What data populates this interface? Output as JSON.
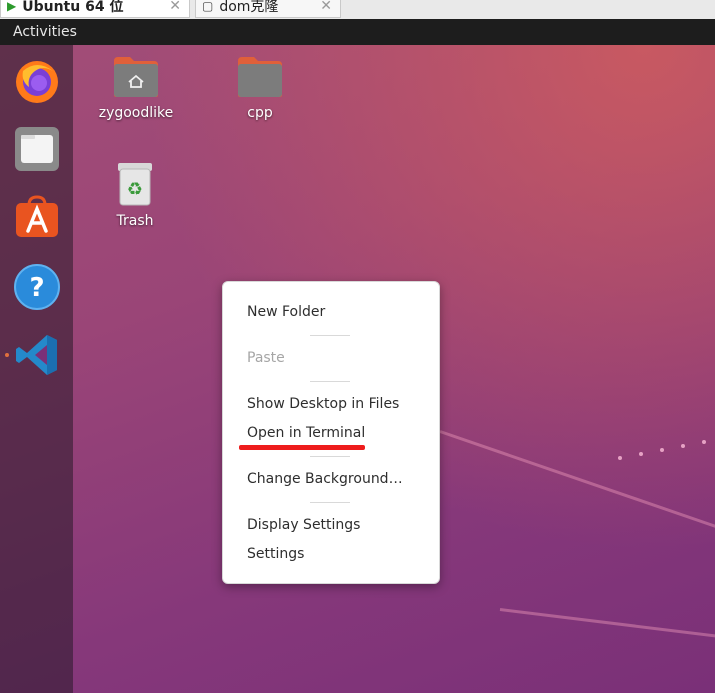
{
  "host_tabs": [
    {
      "label": "Ubuntu 64 位",
      "close": "✕"
    },
    {
      "label": "dom克隆",
      "close": "✕"
    }
  ],
  "top_bar": {
    "activities": "Activities"
  },
  "dock": {
    "items": [
      "firefox-icon",
      "files-icon",
      "software-icon",
      "help-icon",
      "vscode-icon"
    ]
  },
  "desktop_icons": [
    {
      "label": "zygoodlike",
      "icon": "home-folder-icon"
    },
    {
      "label": "cpp",
      "icon": "folder-icon"
    },
    {
      "label": "Trash",
      "icon": "trash-icon"
    }
  ],
  "context_menu": {
    "new_folder": "New Folder",
    "paste": "Paste",
    "show_desktop_in_files": "Show Desktop in Files",
    "open_in_terminal": "Open in Terminal",
    "change_background": "Change Background…",
    "display_settings": "Display Settings",
    "settings": "Settings"
  },
  "colors": {
    "annotation_underline": "#ee1c1c",
    "top_bar": "#1d1d1d",
    "accent_orange": "#e95420"
  }
}
